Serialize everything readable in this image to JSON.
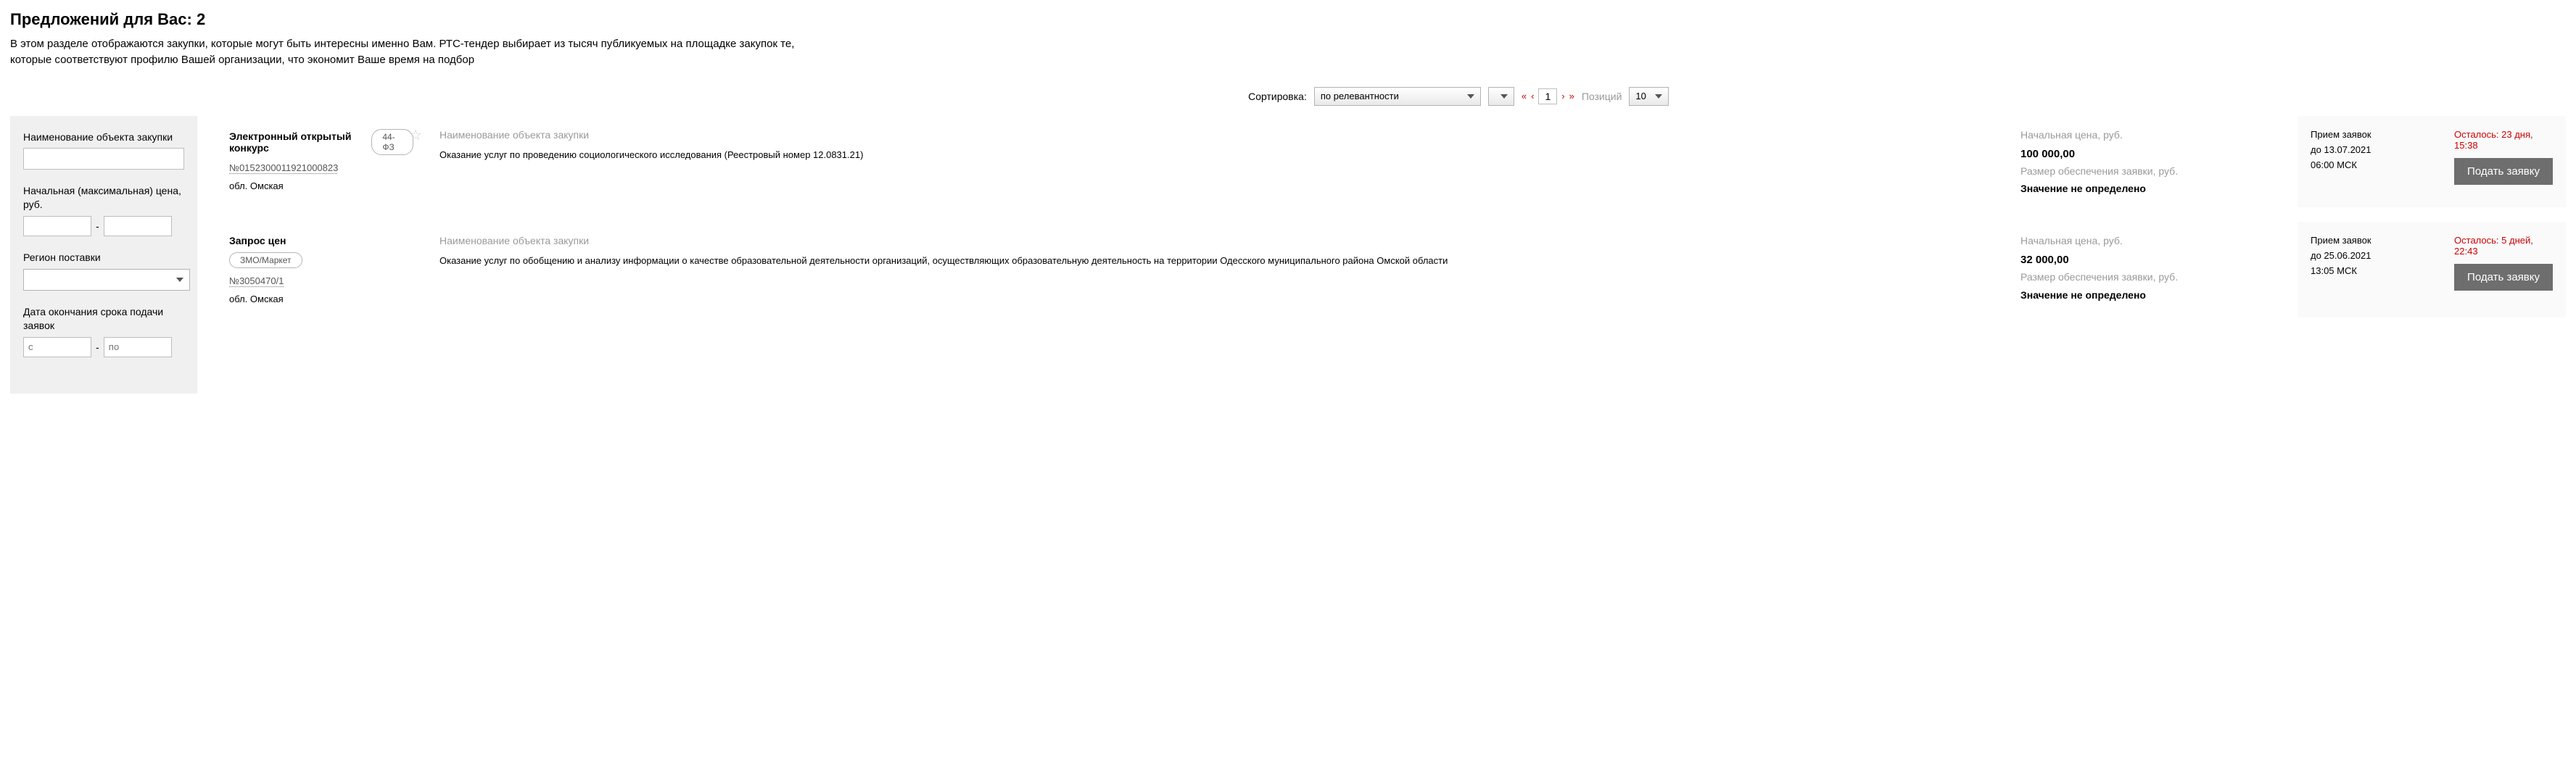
{
  "header": {
    "title": "Предложений для Вас: 2",
    "intro": "В этом разделе отображаются закупки, которые могут быть интересны именно Вам. РТС-тендер выбирает из тысяч публикуемых на площадке закупок те, которые соответствуют профилю Вашей организации, что экономит Ваше время на подбор"
  },
  "toolbar": {
    "sort_label": "Сортировка:",
    "sort_value": "по релевантности",
    "page": "1",
    "positions_label": "Позиций",
    "positions_value": "10"
  },
  "filters": {
    "name_label": "Наименование объекта закупки",
    "name_value": "",
    "price_label": "Начальная (максимальная) цена, руб.",
    "price_from": "",
    "price_to": "",
    "region_label": "Регион поставки",
    "region_value": "",
    "deadline_label": "Дата окончания срока подачи заявок",
    "from_placeholder": "с",
    "to_placeholder": "по"
  },
  "cards": [
    {
      "type": "Электронный открытый конкурс",
      "badge": "44-ФЗ",
      "reg": "№0152300011921000823",
      "region": "обл. Омская",
      "obj_label": "Наименование объекта закупки",
      "desc": "Оказание услуг по проведению социологического исследования (Реестровый номер 12.0831.21)",
      "price_label": "Начальная цена, руб.",
      "price": "100 000,00",
      "dep_label": "Размер обеспечения заявки, руб.",
      "dep_value": "Значение не определено",
      "apply_title": "Прием заявок",
      "until": "до 13.07.2021",
      "time": "06:00 МСК",
      "remaining": "Осталось: 23 дня, 15:38",
      "btn": "Подать заявку"
    },
    {
      "type": "Запрос цен",
      "badge": "ЗМО/Маркет",
      "reg": "№3050470/1",
      "region": "обл. Омская",
      "obj_label": "Наименование объекта закупки",
      "desc": "Оказание услуг по обобщению и анализу информации о качестве образовательной деятельности организаций, осуществляющих образовательную деятельность на территории Одесского муниципального района Омской области",
      "price_label": "Начальная цена, руб.",
      "price": "32 000,00",
      "dep_label": "Размер обеспечения заявки, руб.",
      "dep_value": "Значение не определено",
      "apply_title": "Прием заявок",
      "until": "до 25.06.2021",
      "time": "13:05 МСК",
      "remaining": "Осталось: 5 дней, 22:43",
      "btn": "Подать заявку"
    }
  ]
}
